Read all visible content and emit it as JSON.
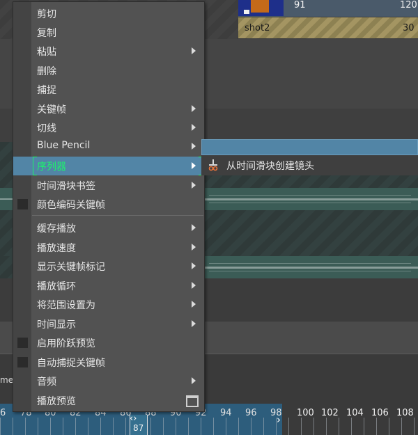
{
  "shots": [
    {
      "name": "",
      "start": "91",
      "end": "120"
    },
    {
      "name": "shot2",
      "start": "",
      "end": "30"
    }
  ],
  "left_label_fragment": "me",
  "ruler": {
    "left_ticks": [
      "6",
      "78",
      "80",
      "82",
      "84",
      "86",
      "88",
      "90",
      "92",
      "94",
      "96",
      "98"
    ],
    "right_ticks": [
      "100",
      "102",
      "104",
      "106",
      "108"
    ],
    "current_frame": "87"
  },
  "context_menu": {
    "items": [
      {
        "label": "剪切"
      },
      {
        "label": "复制"
      },
      {
        "label": "粘贴",
        "submenu": true
      },
      {
        "label": "删除"
      },
      {
        "label": "捕捉"
      },
      {
        "label": "关键帧",
        "submenu": true
      },
      {
        "label": "切线",
        "submenu": true
      },
      {
        "label": "Blue Pencil",
        "submenu": true
      },
      {
        "label": "序列器",
        "submenu": true,
        "highlighted": true
      },
      {
        "label": "时间滑块书签",
        "submenu": true
      },
      {
        "label": "颜色编码关键帧",
        "checkbox": true
      },
      {
        "label": "缓存播放",
        "submenu": true
      },
      {
        "label": "播放速度",
        "submenu": true
      },
      {
        "label": "显示关键帧标记",
        "submenu": true
      },
      {
        "label": "播放循环",
        "submenu": true
      },
      {
        "label": "将范围设置为",
        "submenu": true
      },
      {
        "label": "时间显示",
        "submenu": true
      },
      {
        "label": "启用阶跃预览",
        "checkbox": true
      },
      {
        "label": "自动捕捉关键帧",
        "checkbox": true
      },
      {
        "label": "音频",
        "submenu": true
      },
      {
        "label": "播放预览",
        "option_box": true
      }
    ]
  },
  "submenu": {
    "icon": "scissors-icon",
    "item_label": "从时间滑块创建镜头"
  },
  "colors": {
    "highlight": "#5285a6",
    "highlight_text": "#1cf56b",
    "menu_bg": "#525252",
    "shot_gold": "#a49562",
    "ruler_blue": "#2d5d7c"
  }
}
